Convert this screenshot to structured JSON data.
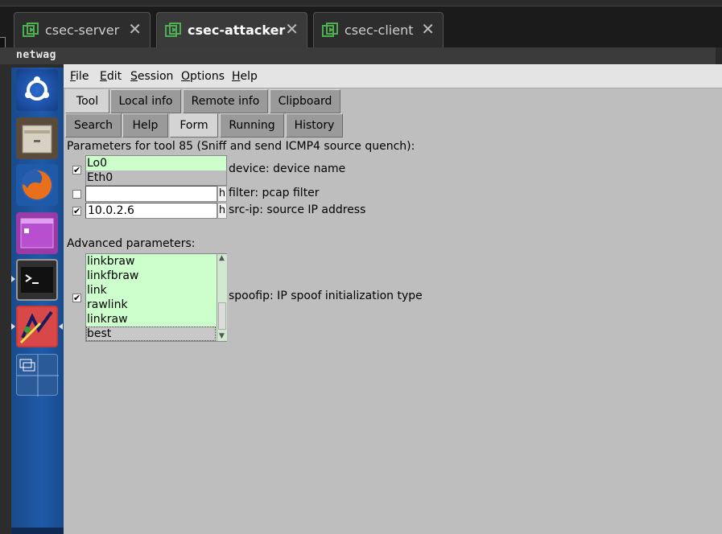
{
  "terminal_tabs": [
    {
      "label": "csec-server",
      "active": false
    },
    {
      "label": "csec-attacker",
      "active": true
    },
    {
      "label": "csec-client",
      "active": false
    }
  ],
  "window_title": "netwag",
  "launcher": [
    "ubuntu-dash-icon",
    "files-icon",
    "firefox-icon",
    "window-app-icon",
    "terminal-icon",
    "netwag-icon",
    "workspace-switcher-icon"
  ],
  "menubar": {
    "file": {
      "u": "F",
      "rest": "ile"
    },
    "edit": {
      "u": "E",
      "rest": "dit"
    },
    "session": {
      "u": "S",
      "rest": "ession"
    },
    "options": {
      "u": "O",
      "rest": "ptions"
    },
    "help": {
      "u": "H",
      "rest": "elp"
    }
  },
  "main_tabs": [
    "Tool",
    "Local info",
    "Remote info",
    "Clipboard"
  ],
  "sub_tabs": [
    "Search",
    "Help",
    "Form",
    "Running",
    "History"
  ],
  "form": {
    "heading": "Parameters for tool 85 (Sniff and send ICMP4 source quench):",
    "device": {
      "checked": "✔",
      "options": [
        "Lo0",
        "Eth0"
      ],
      "label": "device: device name"
    },
    "filter": {
      "checked": "",
      "value": "",
      "button": "h",
      "label": "filter: pcap filter"
    },
    "srcip": {
      "checked": "✔",
      "value": "10.0.2.6",
      "button": "h",
      "label": "src-ip: source IP address"
    },
    "advanced_heading": "Advanced parameters:",
    "spoofip": {
      "checked": "✔",
      "options": [
        "linkbraw",
        "linkfbraw",
        "link",
        "rawlink",
        "linkraw",
        "best"
      ],
      "selected": "best",
      "label": "spoofip: IP spoof initialization type"
    }
  },
  "colors": {
    "listbox_bg": "#ccffcc",
    "app_bg": "#bebebe",
    "launcher_blue": "#1f5aa8"
  }
}
